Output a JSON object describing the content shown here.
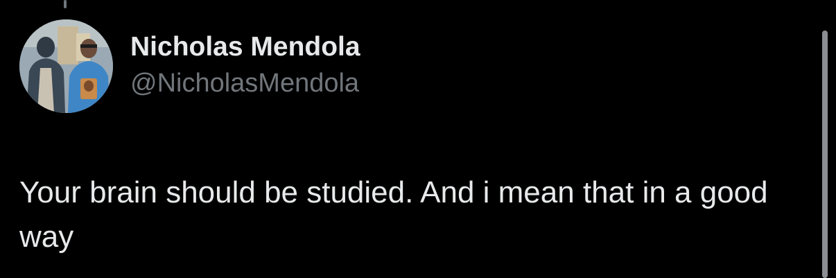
{
  "author": {
    "display_name": "Nicholas Mendola",
    "handle": "@NicholasMendola",
    "avatar_icon": "profile-photo-two-people"
  },
  "tweet": {
    "text": "Your brain should be studied. And i mean that in a good way"
  },
  "colors": {
    "background": "#000000",
    "primary_text": "#e7e9ea",
    "secondary_text": "#71767b"
  }
}
